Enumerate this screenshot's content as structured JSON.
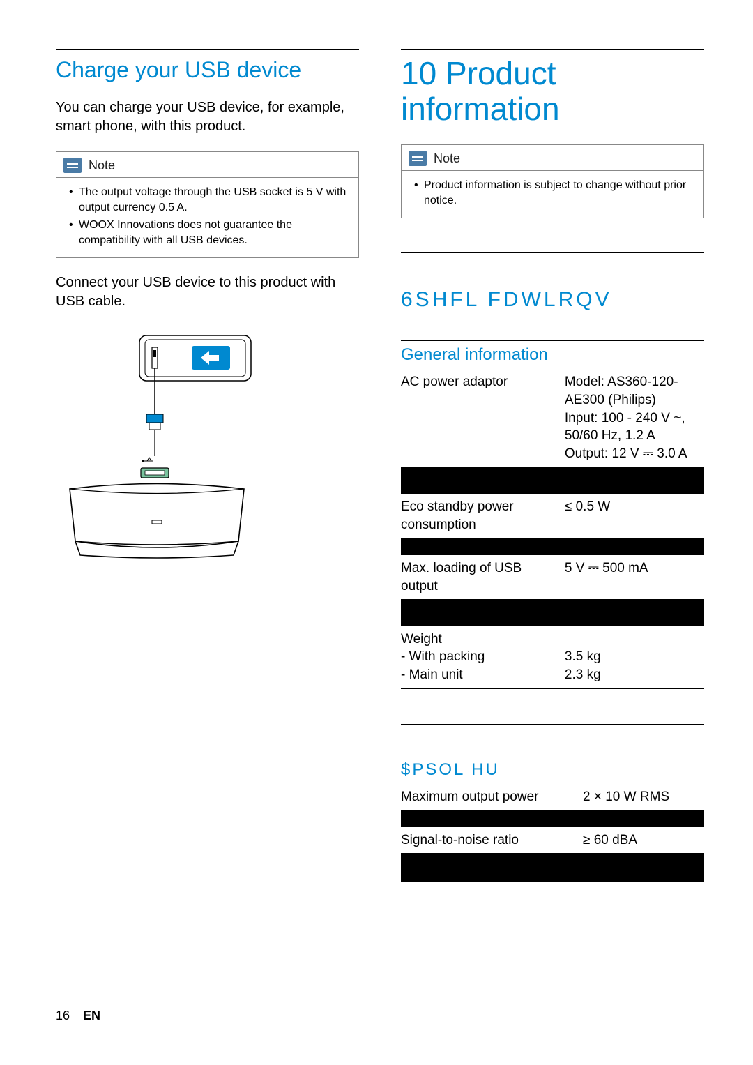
{
  "left": {
    "heading": "Charge your USB device",
    "intro": "You can charge your USB device, for example, smart phone, with this product.",
    "note_label": "Note",
    "note_items": [
      "The output voltage through the USB socket is 5 V with output currency 0.5 A.",
      "WOOX Innovations does not guarantee the compatibility with all USB devices."
    ],
    "connect_text": "Connect your USB device to this product with USB cable."
  },
  "right": {
    "chapter": "10 Product information",
    "note_label": "Note",
    "note_items": [
      "Product information is subject to change without prior notice."
    ],
    "specs_heading": "6SHFL FDWLRQV",
    "general_heading": "General information",
    "general_rows": [
      {
        "label": "AC power adaptor",
        "value": "Model: AS360-120-AE300 (Philips)\nInput: 100 - 240 V ~, 50/60 Hz, 1.2 A\nOutput: 12 V ⎓ 3.0 A"
      },
      {
        "label": "",
        "value": "",
        "redacted": true,
        "size": "lg"
      },
      {
        "label": "Eco standby power consumption",
        "value": "≤ 0.5 W"
      },
      {
        "label": "",
        "value": "",
        "redacted": true,
        "size": "sm"
      },
      {
        "label": "Max. loading of USB output",
        "value": "5 V ⎓ 500 mA"
      },
      {
        "label": "",
        "value": "",
        "redacted": true,
        "size": "lg"
      },
      {
        "label": "Weight\n- With packing\n- Main unit",
        "value": "\n3.5 kg\n2.3 kg"
      }
    ],
    "amp_heading": "$PSOL HU",
    "amp_rows": [
      {
        "label": "Maximum output power",
        "value": "2 × 10 W RMS"
      },
      {
        "label": "",
        "value": "",
        "redacted": true,
        "size": "sm"
      },
      {
        "label": "Signal-to-noise ratio",
        "value": "≥ 60 dBA"
      },
      {
        "label": "",
        "value": "",
        "redacted": true,
        "size": "lg"
      }
    ]
  },
  "footer": {
    "page": "16",
    "lang": "EN"
  }
}
